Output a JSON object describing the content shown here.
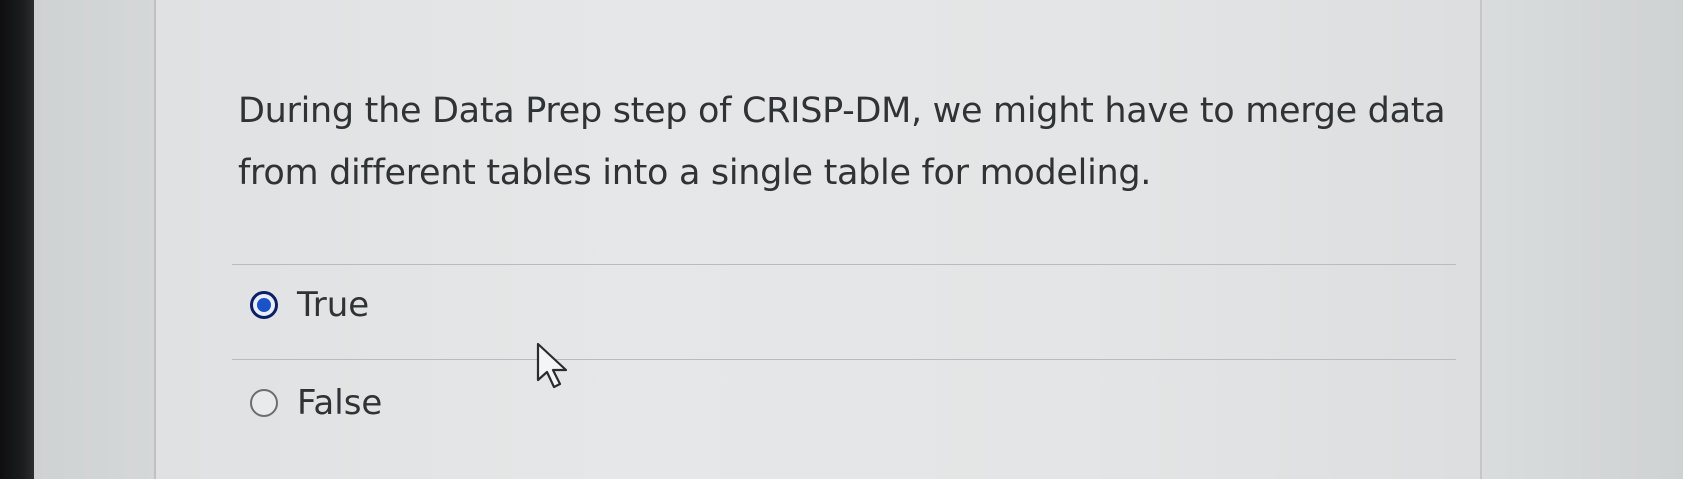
{
  "quiz": {
    "question": "During the Data Prep step of CRISP-DM, we might have to merge data from different tables into a single table for modeling.",
    "selected": "True",
    "options": [
      {
        "label": "True",
        "checked": true
      },
      {
        "label": "False",
        "checked": false
      }
    ]
  },
  "colors": {
    "text": "#2f3336",
    "radio_selected": "#1a52c8",
    "radio_ring": "#0a1f66",
    "background": "#e3e5e6"
  },
  "icons": {
    "radio_checked": "radio-checked-icon",
    "radio_unchecked": "radio-unchecked-icon",
    "cursor": "mouse-pointer-icon"
  }
}
